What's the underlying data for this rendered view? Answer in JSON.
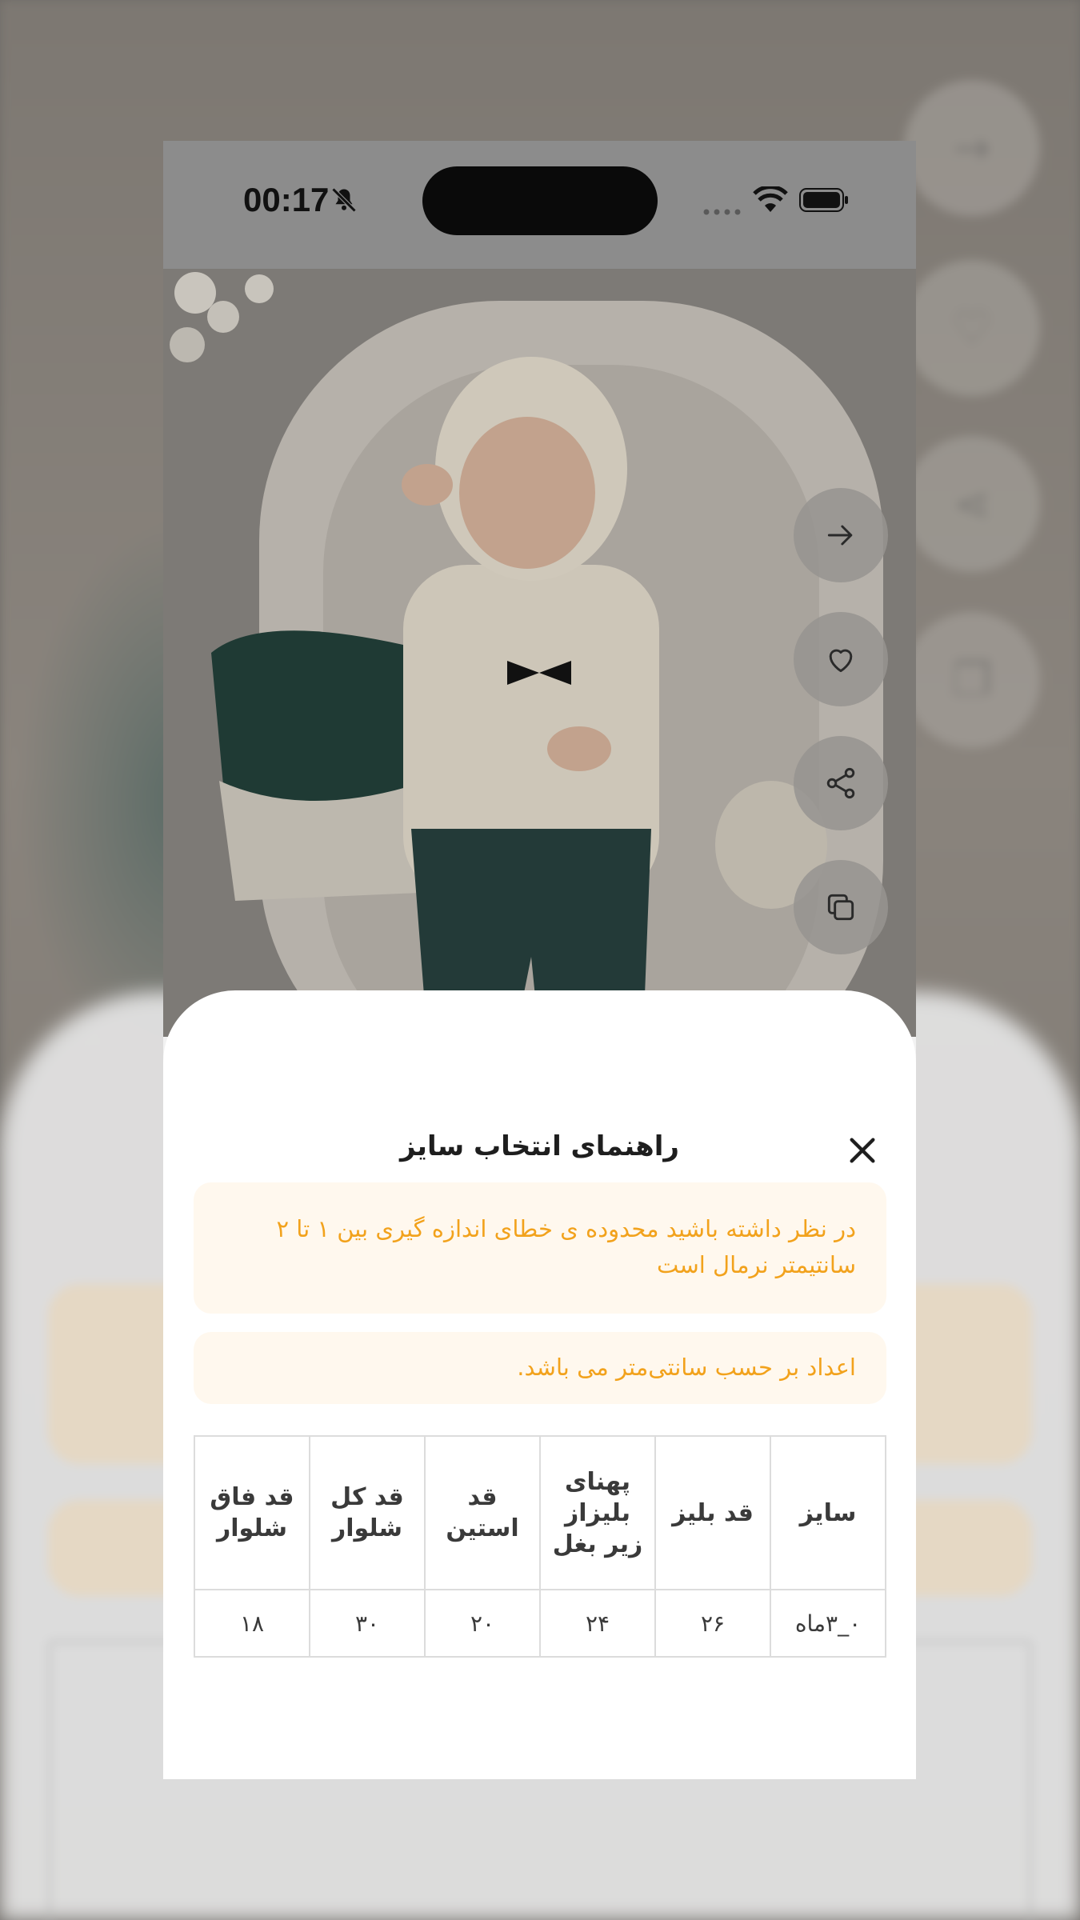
{
  "status_bar": {
    "time": "00:17"
  },
  "actions": [
    {
      "name": "forward-button",
      "icon": "arrow-right-icon"
    },
    {
      "name": "favorite-button",
      "icon": "heart-icon"
    },
    {
      "name": "share-button",
      "icon": "share-icon"
    },
    {
      "name": "copy-button",
      "icon": "copy-icon"
    }
  ],
  "sheet": {
    "title": "راهنمای انتخاب سایز",
    "close_icon": "close-icon",
    "notice_tolerance": "در نظر داشته باشید محدوده ی خطای اندازه گیری بین ۱ تا ۲ سانتیمتر نرمال است",
    "notice_units": "اعداد بر حسب سانتی‌متر می باشد."
  },
  "size_table": {
    "headers": [
      "سایز",
      "قد بلیز",
      "پهنای بلیزاز زیر بغل",
      "قد استین",
      "قد کل شلوار",
      "قد فاق شلوار"
    ],
    "rows": [
      [
        "۰_۳ماه",
        "۲۶",
        "۲۴",
        "۲۰",
        "۳۰",
        "۱۸"
      ]
    ]
  },
  "colors": {
    "accent": "#f2a21c",
    "notice_bg": "#fff8ee",
    "overlay": "#6f6c68"
  }
}
